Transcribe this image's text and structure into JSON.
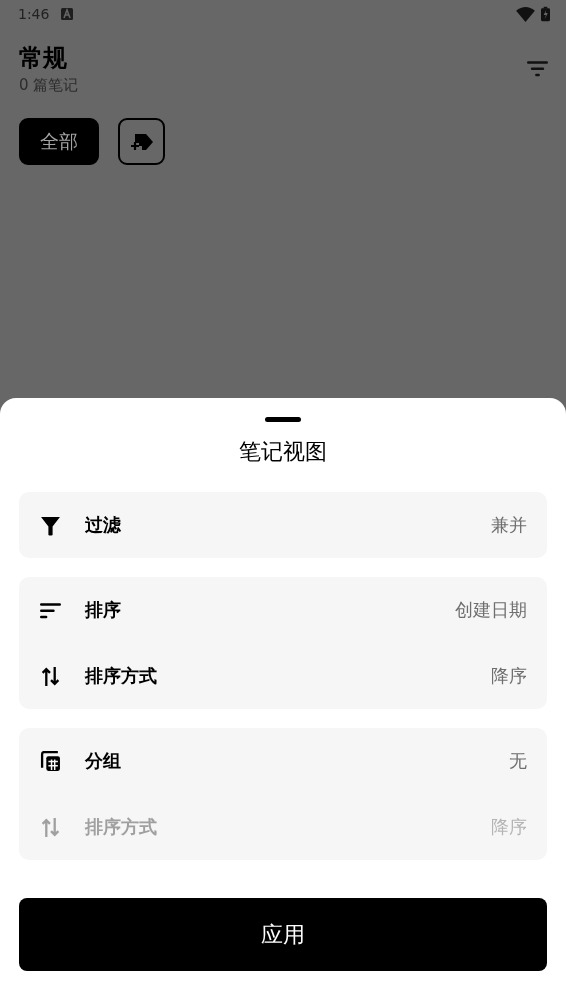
{
  "status_bar": {
    "time": "1:46"
  },
  "header": {
    "title": "常规",
    "subtitle": "0 篇笔记"
  },
  "chips": [
    {
      "label": "全部",
      "selected": true
    }
  ],
  "sheet": {
    "title": "笔记视图",
    "groups": [
      {
        "rows": [
          {
            "kind": "filter",
            "label": "过滤",
            "value": "兼并",
            "disabled": false
          }
        ]
      },
      {
        "rows": [
          {
            "kind": "sort",
            "label": "排序",
            "value": "创建日期",
            "disabled": false
          },
          {
            "kind": "order",
            "label": "排序方式",
            "value": "降序",
            "disabled": false
          }
        ]
      },
      {
        "rows": [
          {
            "kind": "group",
            "label": "分组",
            "value": "无",
            "disabled": false
          },
          {
            "kind": "order",
            "label": "排序方式",
            "value": "降序",
            "disabled": true
          }
        ]
      }
    ],
    "apply_button": "应用"
  }
}
